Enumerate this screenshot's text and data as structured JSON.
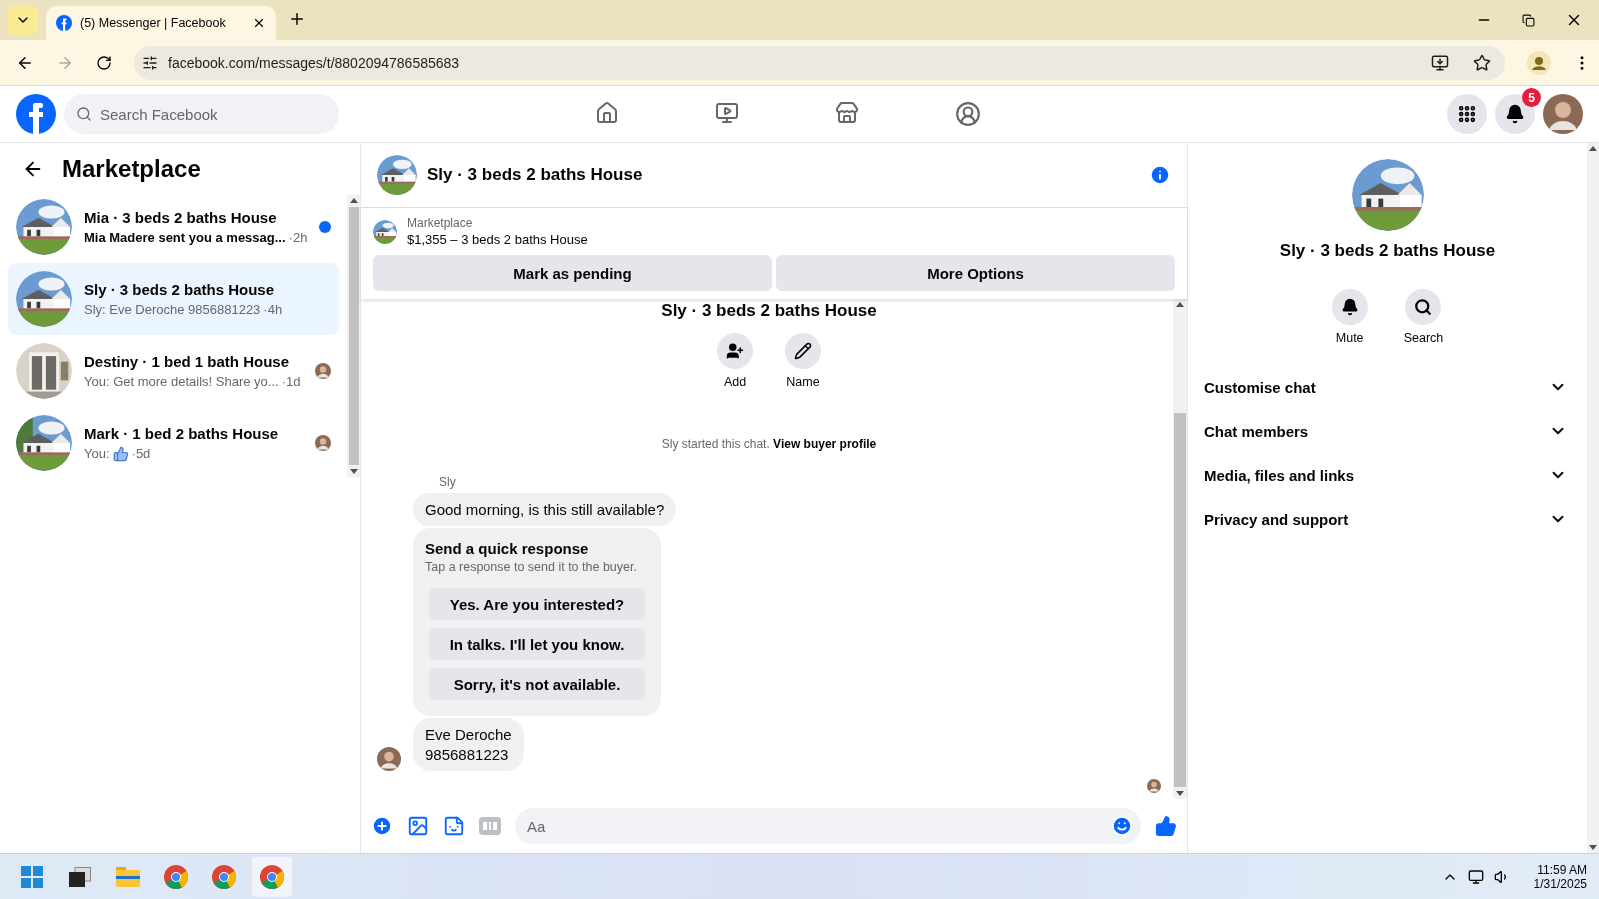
{
  "browser": {
    "tab_title": "(5) Messenger | Facebook",
    "url": "facebook.com/messages/t/8802094786585683"
  },
  "header": {
    "search_placeholder": "Search Facebook",
    "notification_count": "5"
  },
  "sidebar": {
    "title": "Marketplace",
    "conversations": [
      {
        "title": "Mia · 3 beds 2 baths House",
        "preview": "Mia Madere sent you a messag...",
        "time": "·2h",
        "selected": false,
        "unread": true,
        "seen_avatar": false,
        "like_sticker": false
      },
      {
        "title": "Sly · 3 beds 2 baths House",
        "preview": "Sly: Eve Deroche 9856881223",
        "time": "·4h",
        "selected": true,
        "unread": false,
        "seen_avatar": false,
        "like_sticker": false
      },
      {
        "title": "Destiny · 1 bed 1 bath House",
        "preview": "You: Get more details! Share yo...",
        "time": "·1d",
        "selected": false,
        "unread": false,
        "seen_avatar": true,
        "like_sticker": false
      },
      {
        "title": "Mark · 1 bed 2 baths House",
        "preview": "You:",
        "time": "·5d",
        "selected": false,
        "unread": false,
        "seen_avatar": true,
        "like_sticker": true
      }
    ]
  },
  "chat": {
    "title": "Sly · 3 beds 2 baths House",
    "listing": {
      "label": "Marketplace",
      "price_line": "$1,355 – 3 beds 2 baths House"
    },
    "actions": [
      "Mark as pending",
      "More Options"
    ],
    "intro": {
      "title": "Sly · 3 beds 2 baths House",
      "actions": [
        {
          "kind": "add",
          "label": "Add"
        },
        {
          "kind": "name",
          "label": "Name"
        }
      ],
      "started": "Sly started this chat.",
      "link": "View buyer profile"
    },
    "sender": "Sly",
    "messages": [
      {
        "kind": "text",
        "lines": [
          "Good morning, is this still available?"
        ]
      },
      {
        "kind": "quick_response",
        "title": "Send a quick response",
        "subtitle": "Tap a response to send it to the buyer.",
        "options": [
          "Yes. Are you interested?",
          "In talks. I'll let you know.",
          "Sorry, it's not available."
        ]
      },
      {
        "kind": "text",
        "lines": [
          "Eve Deroche",
          "9856881223"
        ]
      }
    ],
    "composer": {
      "placeholder": "Aa"
    }
  },
  "details": {
    "title": "Sly · 3 beds 2 baths House",
    "actions": [
      {
        "kind": "mute",
        "label": "Mute"
      },
      {
        "kind": "search",
        "label": "Search"
      }
    ],
    "sections": [
      {
        "label": "Customise chat",
        "expanded": false
      },
      {
        "label": "Chat members",
        "expanded": false
      },
      {
        "label": "Media, files and links",
        "expanded": false
      },
      {
        "label": "Privacy and support",
        "expanded": false
      }
    ]
  },
  "taskbar": {
    "time": "11:59 AM",
    "date": "1/31/2025"
  }
}
